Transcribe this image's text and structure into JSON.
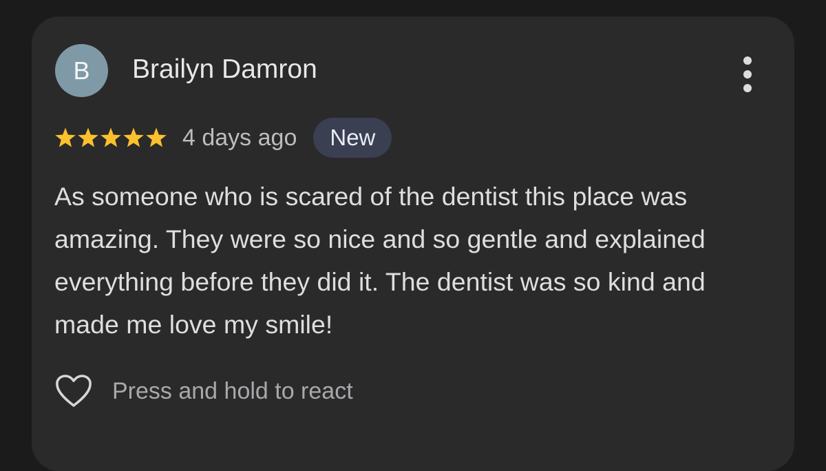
{
  "review": {
    "avatar_initial": "B",
    "avatar_color": "#7f9aa6",
    "reviewer_name": "Brailyn Damron",
    "rating": 5,
    "max_rating": 5,
    "star_color": "#fbc02d",
    "date": "4 days ago",
    "badge": "New",
    "text": "As someone who is scared of the dentist this place was amazing. They were so nice and so gentle and explained everything before they did it. The dentist was so kind and made me love my smile!",
    "react_label": "Press and hold to react"
  },
  "icons": {
    "more": "more-vert-icon",
    "star": "star-icon",
    "react": "heart-outline-icon"
  }
}
